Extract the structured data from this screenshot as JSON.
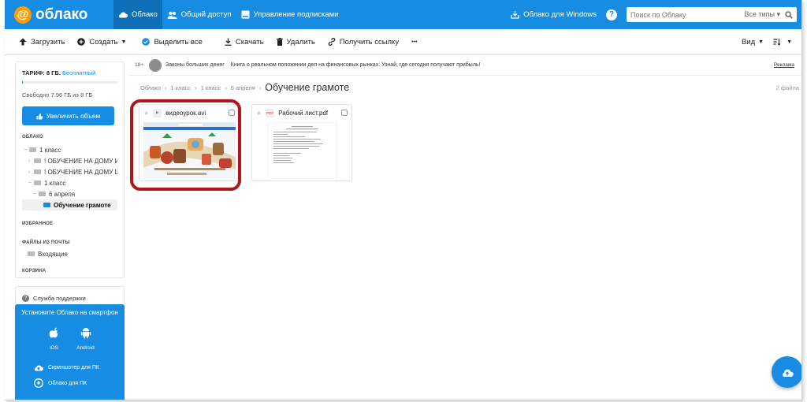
{
  "colors": {
    "brand": "#168de2",
    "highlight": "#b0161d",
    "logo_accent": "#ff9e00"
  },
  "topbar": {
    "logo_text": "облако",
    "nav": [
      {
        "label": "Облако",
        "icon": "cloud-icon"
      },
      {
        "label": "Общий доступ",
        "icon": "users-icon"
      },
      {
        "label": "Управление подписками",
        "icon": "card-icon"
      }
    ],
    "windows_label": "Облако для Windows",
    "help": "?",
    "search_placeholder": "Поиск по Облаку",
    "search_types": "Все типы",
    "search_icon": "search-icon"
  },
  "toolbar": {
    "upload": "Загрузить",
    "create": "Создать",
    "select_all": "Выделить все",
    "download": "Скачать",
    "delete": "Удалить",
    "get_link": "Получить ссылку",
    "more": "•••",
    "view": "Вид"
  },
  "sidebar": {
    "tariff_label": "ТАРИФ: 8 ГБ.",
    "tariff_plan": "Бесплатный",
    "storage_used_fraction": 0.005,
    "free_space": "Свободно 7.96 ГБ из 8 ГБ",
    "upgrade_button": "Увеличить объем",
    "cloud_section": "ОБЛАКО",
    "tree": [
      {
        "label": "1 класс"
      },
      {
        "label": "! ОБУЧЕНИЕ НА ДОМУ И..."
      },
      {
        "label": "! ОБУЧЕНИЕ НА ДОМУ Ш..."
      },
      {
        "label": "1 класс"
      },
      {
        "label": "6 апреля"
      },
      {
        "label": "Обучение грамоте"
      }
    ],
    "favorites_section": "ИЗБРАННОЕ",
    "mail_section": "ФАЙЛЫ ИЗ ПОЧТЫ",
    "inbox": "Входящие",
    "trash_section": "КОРЗИНА",
    "support": "Служба поддержки"
  },
  "promo": {
    "title": "Установите Облако на смартфон",
    "ios": "iOS",
    "android": "Android",
    "screenshoter": "Скриншотер для ПК",
    "cloud_pc": "Облако для ПК"
  },
  "ad": {
    "age": "18+",
    "title": "Законы больших денег",
    "text": "Книга о реальном положении дел на финансовых рынках. Узнай, где сегодня получают прибыль!",
    "label": "Реклама"
  },
  "breadcrumbs": {
    "items": [
      "Облако",
      "1 класс",
      "1 класс",
      "6 апреля"
    ],
    "current": "Обучение грамоте",
    "file_count": "2 файла"
  },
  "files": [
    {
      "name": "видеоурок.avi",
      "type": "video"
    },
    {
      "name": "Рабочий лист.pdf",
      "type": "pdf",
      "badge": "PDF"
    }
  ]
}
